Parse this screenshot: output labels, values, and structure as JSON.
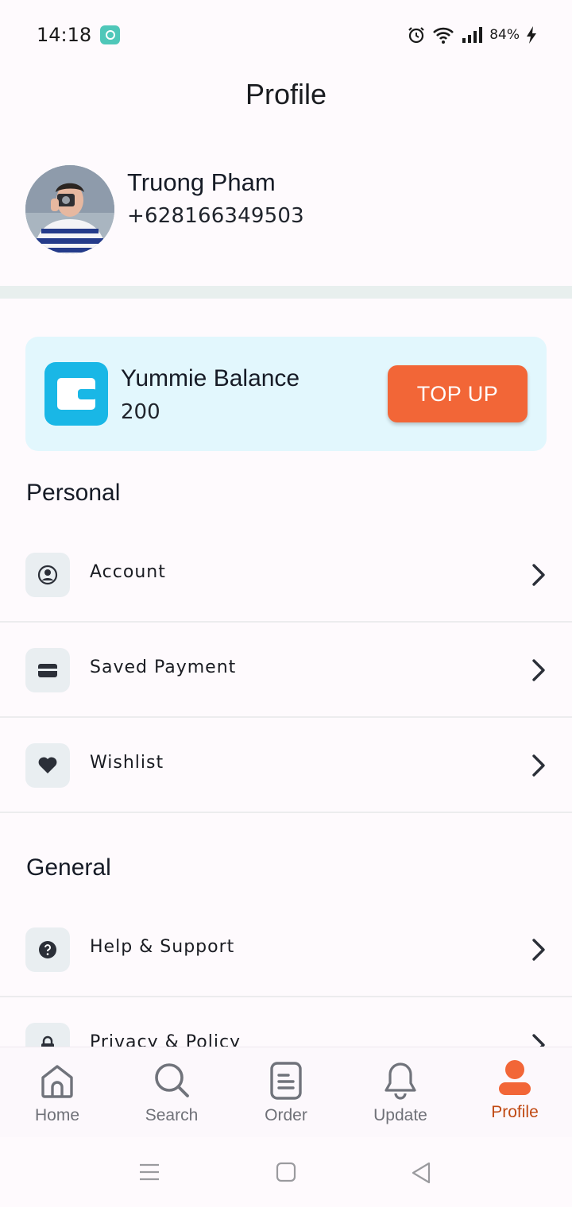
{
  "status_bar": {
    "time": "14:18",
    "battery": "84%"
  },
  "header": {
    "title": "Profile"
  },
  "user": {
    "name": "Truong Pham",
    "phone": "+628166349503"
  },
  "balance": {
    "label": "Yummie Balance",
    "value": "200",
    "topup_label": "TOP UP"
  },
  "sections": {
    "personal": {
      "title": "Personal",
      "items": [
        {
          "label": "Account",
          "icon": "account-circle-icon"
        },
        {
          "label": "Saved Payment",
          "icon": "card-icon"
        },
        {
          "label": "Wishlist",
          "icon": "heart-icon"
        }
      ]
    },
    "general": {
      "title": "General",
      "items": [
        {
          "label": "Help & Support",
          "icon": "help-icon"
        },
        {
          "label": "Privacy & Policy",
          "icon": "lock-icon"
        }
      ]
    }
  },
  "bottom_nav": {
    "items": [
      {
        "label": "Home",
        "icon": "home-icon"
      },
      {
        "label": "Search",
        "icon": "search-icon"
      },
      {
        "label": "Order",
        "icon": "order-icon"
      },
      {
        "label": "Update",
        "icon": "bell-icon"
      },
      {
        "label": "Profile",
        "icon": "profile-icon"
      }
    ],
    "active": "Profile"
  },
  "colors": {
    "accent": "#f26637",
    "active_nav": "#c04a13",
    "balance_bg": "#e2f7fd",
    "wallet": "#19b7e6"
  }
}
